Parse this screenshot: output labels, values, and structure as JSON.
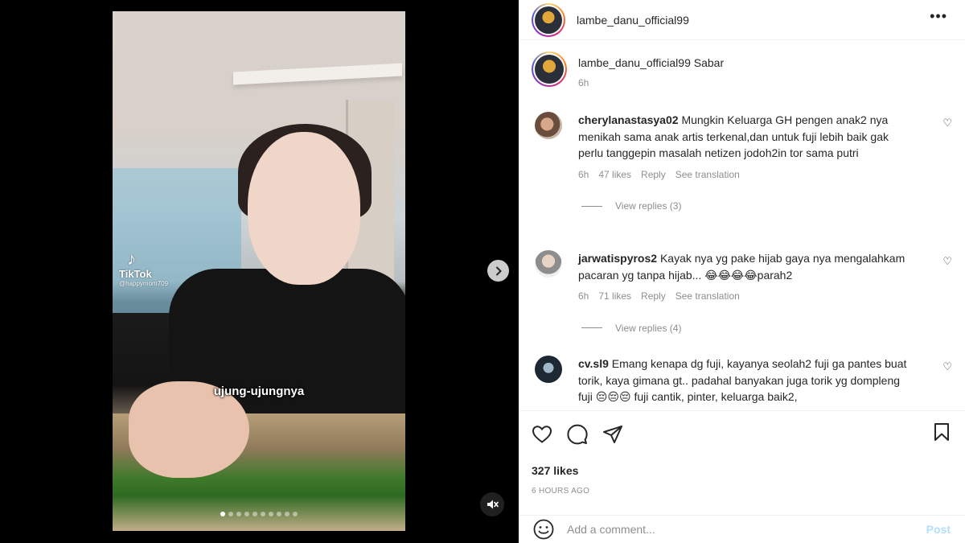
{
  "video": {
    "watermark_brand": "TikTok",
    "watermark_handle": "@happymom709",
    "caption_overlay": "ujung-ujungnya",
    "carousel_total": 10,
    "carousel_active_index": 0
  },
  "header": {
    "username": "lambe_danu_official99"
  },
  "post_caption": {
    "username": "lambe_danu_official99",
    "text": "Sabar",
    "time": "6h"
  },
  "comments": [
    {
      "username": "cherylanastasya02",
      "text": "Mungkin Keluarga GH pengen anak2 nya menikah sama anak artis terkenal,dan untuk fuji lebih baik gak perlu tanggepin masalah netizen jodoh2in tor sama putri",
      "time": "6h",
      "likes": "47 likes",
      "reply_label": "Reply",
      "translate_label": "See translation",
      "view_replies": "View replies (3)"
    },
    {
      "username": "jarwatispyros2",
      "text": "Kayak nya yg pake hijab gaya nya mengalahkam pacaran yg tanpa hijab... 😂😂😂😂parah2",
      "time": "6h",
      "likes": "71 likes",
      "reply_label": "Reply",
      "translate_label": "See translation",
      "view_replies": "View replies (4)"
    },
    {
      "username": "cv.sl9",
      "text": "Emang kenapa dg fuji, kayanya seolah2 fuji ga pantes buat torik, kaya gimana gt.. padahal banyakan juga torik yg dompleng fuji 😔😔😔 fuji cantik, pinter, keluarga baik2,"
    }
  ],
  "actions": {
    "likes": "327 likes",
    "time_ago": "6 HOURS AGO"
  },
  "add_comment": {
    "placeholder": "Add a comment...",
    "post_label": "Post"
  },
  "icons": {
    "next": "chevron-right-icon",
    "mute": "speaker-muted-icon",
    "more": "more-horizontal-icon",
    "like": "heart-icon",
    "comment": "comment-bubble-icon",
    "share": "paper-plane-icon",
    "save": "bookmark-icon",
    "emoji": "smiley-icon"
  },
  "colors": {
    "post_button": "#b2dffc",
    "meta_text": "#8e8e8e",
    "primary_text": "#262626"
  }
}
